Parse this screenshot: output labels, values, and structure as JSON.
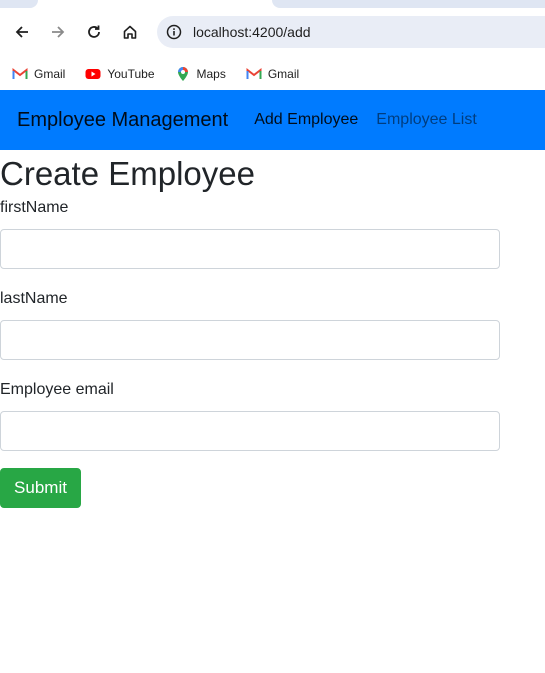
{
  "browser": {
    "url": "localhost:4200/add",
    "bookmarks": [
      {
        "label": "Gmail",
        "icon": "gmail-icon"
      },
      {
        "label": "YouTube",
        "icon": "youtube-icon"
      },
      {
        "label": "Maps",
        "icon": "maps-icon"
      },
      {
        "label": "Gmail",
        "icon": "gmail-icon"
      }
    ]
  },
  "navbar": {
    "brand": "Employee Management",
    "links": [
      "Add Employee",
      "Employee List"
    ],
    "color": "#007bff"
  },
  "form": {
    "title": "Create Employee",
    "fields": [
      {
        "label": "firstName",
        "value": ""
      },
      {
        "label": "lastName",
        "value": ""
      },
      {
        "label": "Employee email",
        "value": ""
      }
    ],
    "submit_label": "Submit",
    "submit_color": "#28a745"
  }
}
